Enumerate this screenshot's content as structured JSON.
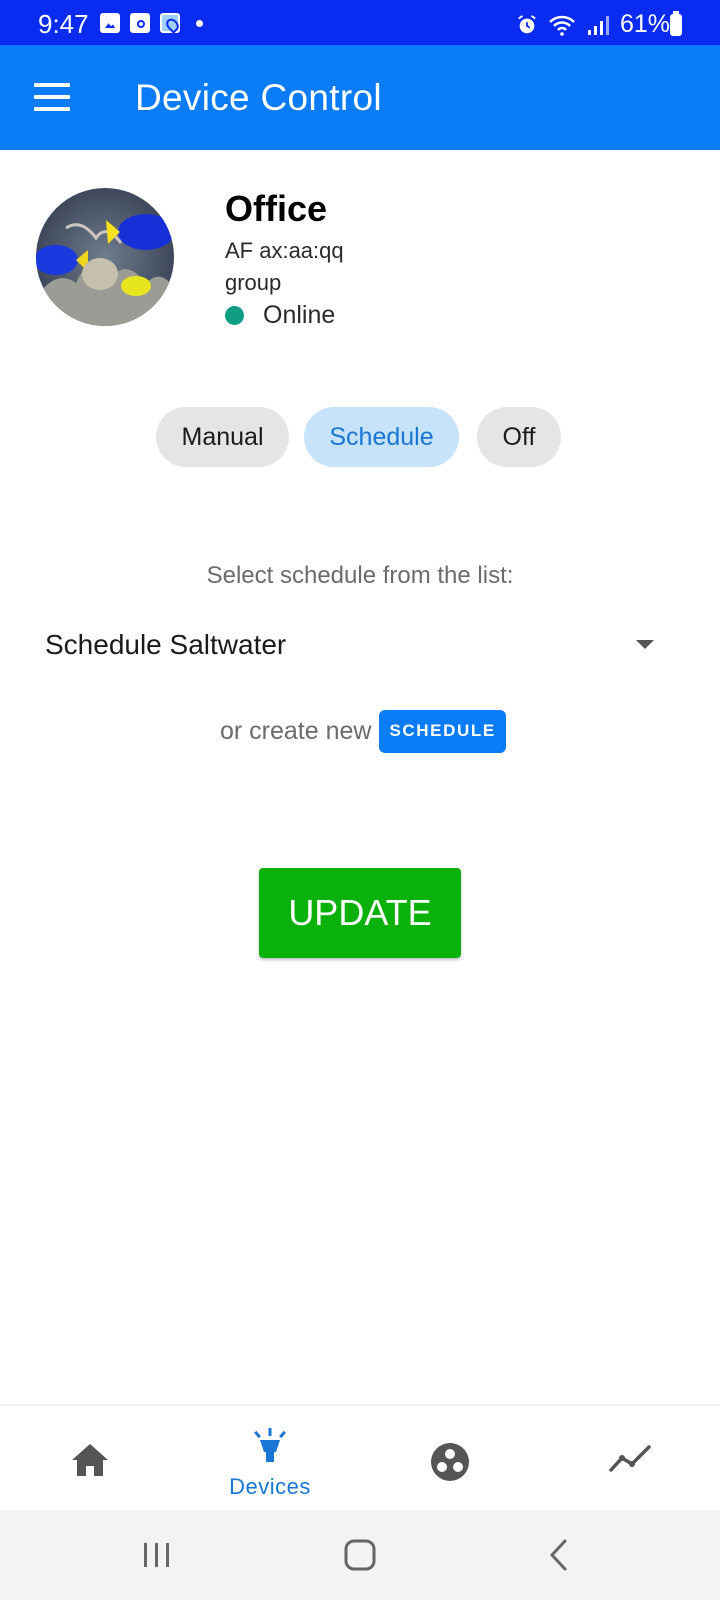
{
  "status_bar": {
    "time": "9:47",
    "battery": "61%",
    "left_icons": [
      "gallery-icon",
      "media-icon",
      "maps-icon",
      "dot"
    ],
    "right_icons": [
      "alarm-icon",
      "wifi-icon",
      "signal-icon",
      "battery-icon"
    ]
  },
  "app_bar": {
    "title": "Device Control",
    "menu_icon": "hamburger-menu-icon",
    "background": "#0a7cf8"
  },
  "device": {
    "name": "Office",
    "mac": "AF ax:aa:qq",
    "type": "group",
    "status": "Online",
    "status_color": "#0f9d84",
    "image": "aquarium-fish-photo"
  },
  "modes": {
    "items": [
      {
        "label": "Manual",
        "active": false
      },
      {
        "label": "Schedule",
        "active": true
      },
      {
        "label": "Off",
        "active": false
      }
    ]
  },
  "schedule": {
    "select_label": "Select schedule from the list:",
    "selected": "Schedule Saltwater",
    "create_text": "or create new",
    "create_button": "SCHEDULE"
  },
  "actions": {
    "update": "UPDATE",
    "update_color": "#0bb10b"
  },
  "bottom_nav": {
    "items": [
      {
        "icon": "home-icon",
        "label": "",
        "active": false
      },
      {
        "icon": "devices-lamp-icon",
        "label": "Devices",
        "active": true
      },
      {
        "icon": "community-icon",
        "label": "",
        "active": false
      },
      {
        "icon": "chart-line-icon",
        "label": "",
        "active": false
      }
    ],
    "active_color": "#1976d2"
  },
  "system_nav": {
    "buttons": [
      "recent-apps-icon",
      "home-circle-icon",
      "back-icon"
    ]
  }
}
